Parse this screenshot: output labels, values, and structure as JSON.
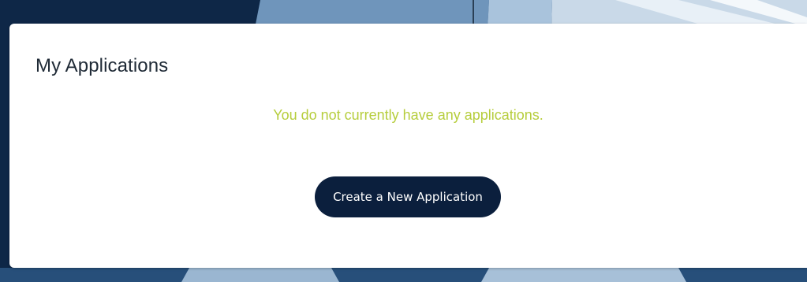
{
  "colors": {
    "card_background": "#ffffff",
    "title_text": "#1f2a36",
    "empty_message_text": "#b6cd3c",
    "button_background": "#0b1f3d",
    "button_text": "#ffffff",
    "backdrop_dark": "#0f2a4a",
    "backdrop_light": "#8fb0cf"
  },
  "applications_panel": {
    "title": "My Applications",
    "empty_message": "You do not currently have any applications.",
    "create_button_label": "Create a New Application"
  }
}
